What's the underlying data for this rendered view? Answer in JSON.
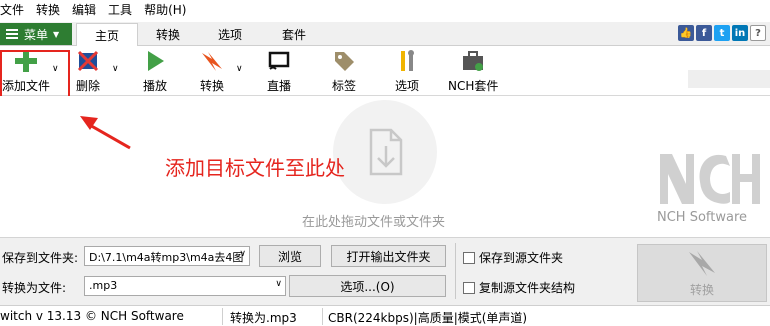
{
  "menubar": {
    "items": [
      "文件",
      "转换",
      "编辑",
      "工具",
      "帮助(H)"
    ]
  },
  "tabs": {
    "menu_label": "菜单",
    "items": [
      "主页",
      "转换",
      "选项",
      "套件"
    ]
  },
  "social": {
    "icons": [
      "thumbs-up-icon",
      "facebook-icon",
      "twitter-icon",
      "linkedin-icon",
      "help-icon"
    ]
  },
  "toolbar": {
    "add_files": "添加文件",
    "delete": "删除",
    "play": "播放",
    "convert": "转换",
    "stream": "直播",
    "tags": "标签",
    "options": "选项",
    "nch_suite": "NCH套件"
  },
  "annotation": {
    "text": "添加目标文件至此处",
    "color": "#e5251e"
  },
  "droparea": {
    "hint": "在此处拖动文件或文件夹"
  },
  "logo": {
    "text": "NCH Software"
  },
  "output": {
    "save_to_label": "保存到文件夹:",
    "save_to_value": "D:\\7.1\\m4a转mp3\\m4a去4图",
    "browse": "浏览",
    "open_output": "打开输出文件夹",
    "convert_to_label": "转换为文件:",
    "format_value": ".mp3",
    "options_button": "选项...(O)",
    "save_to_source": "保存到源文件夹",
    "copy_structure": "复制源文件夹结构",
    "convert_button": "转换"
  },
  "status": {
    "version": "witch v 13.13 © NCH Software",
    "convert_to": "转换为.mp3",
    "quality": "CBR(224kbps)|高质量|模式(单声道)"
  },
  "colors": {
    "menu_button": "#2e7d32",
    "accent_red": "#e5251e"
  }
}
